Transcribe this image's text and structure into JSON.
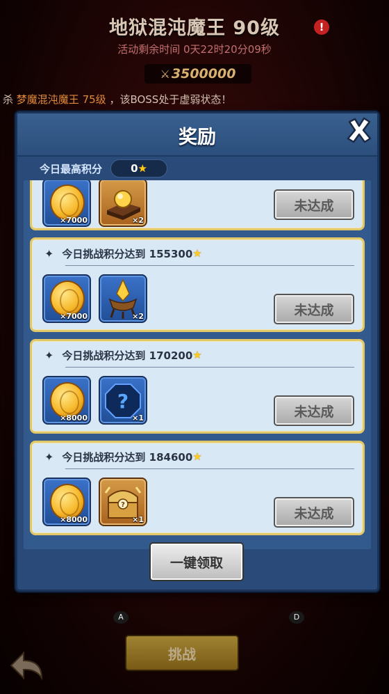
{
  "background": {
    "boss_title": "地狱混沌魔王 90级",
    "alert_glyph": "!",
    "time_label": "活动剩余时间",
    "time_value": "0天22时20分09秒",
    "score": "3500000",
    "ticker_prefix": "杀",
    "ticker_highlight": "梦魔混沌魔王 75级",
    "ticker_suffix": "，该BOSS处于虚弱状态！",
    "slot_a": "A",
    "slot_d": "D",
    "challenge_label": "挑战"
  },
  "modal": {
    "title": "奖励",
    "close_icon": "close-x-icon",
    "highscore_label": "今日最高积分",
    "highscore_value": "0",
    "claim_all_label": "一键领取",
    "cards": [
      {
        "title": "",
        "items": [
          {
            "icon": "gold-coin-icon",
            "qty": "×7000"
          },
          {
            "icon": "treasure-box-icon",
            "qty": "×2"
          }
        ],
        "button": "未达成"
      },
      {
        "title": "今日挑战积分达到 155300",
        "items": [
          {
            "icon": "gold-coin-icon",
            "qty": "×7000"
          },
          {
            "icon": "crystal-brazier-icon",
            "qty": "×2"
          }
        ],
        "button": "未达成"
      },
      {
        "title": "今日挑战积分达到 170200",
        "items": [
          {
            "icon": "gold-coin-icon",
            "qty": "×8000"
          },
          {
            "icon": "mystery-item-icon",
            "qty": "×1"
          }
        ],
        "button": "未达成"
      },
      {
        "title": "今日挑战积分达到 184600",
        "items": [
          {
            "icon": "gold-coin-icon",
            "qty": "×8000"
          },
          {
            "icon": "treasure-chest-icon",
            "qty": "×1"
          }
        ],
        "button": "未达成"
      }
    ]
  },
  "colors": {
    "card_border": "#e3c86a",
    "card_bg": "#d8e8f5",
    "modal_bg": "#2a4a7a",
    "star": "#ffcc1e"
  }
}
